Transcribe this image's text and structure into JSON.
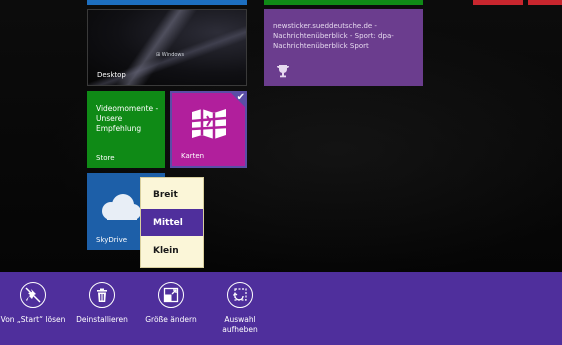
{
  "start_screen": {
    "tiles": {
      "desktop": {
        "label": "Desktop",
        "logo_text": "Windows"
      },
      "news": {
        "lines": [
          "newsticker.sueddeutsche.de -",
          "Nachrichtenüberblick - Sport: dpa-",
          "Nachrichtenüberblick Sport"
        ],
        "icon": "trophy-icon"
      },
      "store": {
        "lines": [
          "Videomomente -",
          "Unsere",
          "Empfehlung"
        ],
        "label": "Store"
      },
      "maps": {
        "label": "Karten",
        "selected": true
      },
      "skydrive": {
        "label": "SkyDrive"
      }
    }
  },
  "size_menu": {
    "options": [
      {
        "label": "Breit",
        "selected": false
      },
      {
        "label": "Mittel",
        "selected": true
      },
      {
        "label": "Klein",
        "selected": false
      }
    ]
  },
  "app_bar": {
    "commands": [
      {
        "label": "Von „Start“ lösen",
        "icon": "unpin-icon"
      },
      {
        "label": "Deinstallieren",
        "icon": "uninstall-icon"
      },
      {
        "label": "Größe ändern",
        "icon": "resize-icon"
      },
      {
        "label_line1": "Auswahl",
        "label_line2": "aufheben",
        "icon": "clear-selection-icon"
      }
    ]
  },
  "colors": {
    "accent": "#4f2f9c",
    "store_tile": "#0f8a16",
    "maps_tile": "#b11f9c",
    "skydrive_tile": "#1d5fa8",
    "news_tile": "#6b3d8e",
    "menu_bg": "#fbf6d8"
  }
}
